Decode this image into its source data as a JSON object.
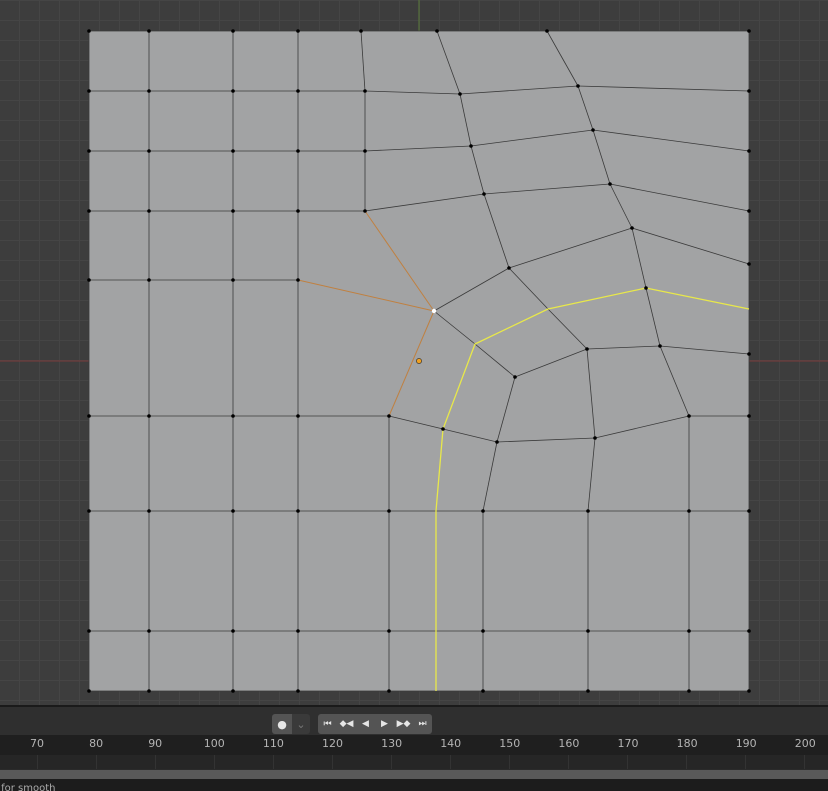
{
  "viewport": {
    "mesh_color": "#a2a3a4",
    "edge_color": "#3a3a3a",
    "selected_edge_color": "#e8e84a",
    "active_edge_color": "#c08040",
    "origin_color": "#f0a020"
  },
  "playback": {
    "record_icon": "record-dot-icon",
    "dropdown_icon": "chevron-down-icon",
    "buttons": [
      {
        "icon": "jump-start-icon",
        "glyph": "⏮"
      },
      {
        "icon": "prev-keyframe-icon",
        "glyph": "◆◀"
      },
      {
        "icon": "play-reverse-icon",
        "glyph": "◀"
      },
      {
        "icon": "play-icon",
        "glyph": "▶"
      },
      {
        "icon": "next-keyframe-icon",
        "glyph": "▶◆"
      },
      {
        "icon": "jump-end-icon",
        "glyph": "⏭"
      }
    ]
  },
  "timeline": {
    "ticks": [
      "70",
      "80",
      "90",
      "100",
      "110",
      "120",
      "130",
      "140",
      "150",
      "160",
      "170",
      "180",
      "190",
      "200"
    ]
  },
  "status": {
    "text": "t for smooth"
  }
}
